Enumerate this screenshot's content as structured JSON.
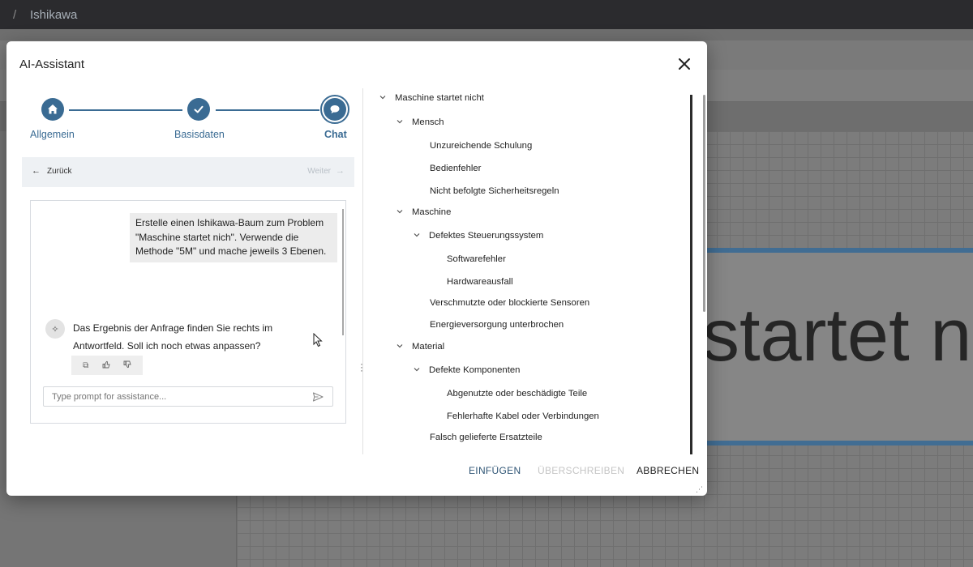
{
  "app": {
    "breadcrumb_sep": "/",
    "title": "Ishikawa",
    "canvas_node_text": "startet nic"
  },
  "dialog": {
    "title": "AI-Assistant",
    "close_icon": "close-icon",
    "accent_color": "#3a6b93"
  },
  "stepper": {
    "steps": [
      {
        "label": "Allgemein",
        "icon": "home-icon"
      },
      {
        "label": "Basisdaten",
        "icon": "check-icon"
      },
      {
        "label": "Chat",
        "icon": "chat-bubble-icon"
      }
    ],
    "active_step": "Chat"
  },
  "nav": {
    "back_label": "Zurück",
    "next_label": "Weiter"
  },
  "chat": {
    "user_message": "Erstelle einen Ishikawa-Baum zum Problem \"Maschine startet nich\". Verwende die Methode \"5M\" und mache jeweils 3 Ebenen.",
    "ai_message": "Das Ergebnis der Anfrage finden Sie rechts im Antwortfeld. Soll ich noch etwas anpassen?",
    "actions": [
      "copy-icon",
      "thumbs-up-icon",
      "thumbs-down-icon"
    ],
    "prompt_placeholder": "Type prompt for assistance..."
  },
  "tree": {
    "items": [
      {
        "label": "Maschine startet nicht",
        "level": 0,
        "expanded": true
      },
      {
        "label": "Mensch",
        "level": 1,
        "expanded": true
      },
      {
        "label": "Unzureichende Schulung",
        "level": 2
      },
      {
        "label": "Bedienfehler",
        "level": 2
      },
      {
        "label": "Nicht befolgte Sicherheitsregeln",
        "level": 2
      },
      {
        "label": "Maschine",
        "level": 1,
        "expanded": true
      },
      {
        "label": "Defektes Steuerungssystem",
        "level": 2,
        "expanded": true
      },
      {
        "label": "Softwarefehler",
        "level": 3
      },
      {
        "label": "Hardwareausfall",
        "level": 3
      },
      {
        "label": "Verschmutzte oder blockierte Sensoren",
        "level": 2
      },
      {
        "label": "Energieversorgung unterbrochen",
        "level": 2
      },
      {
        "label": "Material",
        "level": 1,
        "expanded": true
      },
      {
        "label": "Defekte Komponenten",
        "level": 2,
        "expanded": true
      },
      {
        "label": "Abgenutzte oder beschädigte Teile",
        "level": 3
      },
      {
        "label": "Fehlerhafte Kabel oder Verbindungen",
        "level": 3
      },
      {
        "label": "Falsch gelieferte Ersatzteile",
        "level": 2
      }
    ]
  },
  "footer": {
    "insert_label": "EINFÜGEN",
    "overwrite_label": "ÜBERSCHREIBEN",
    "cancel_label": "ABBRECHEN"
  }
}
